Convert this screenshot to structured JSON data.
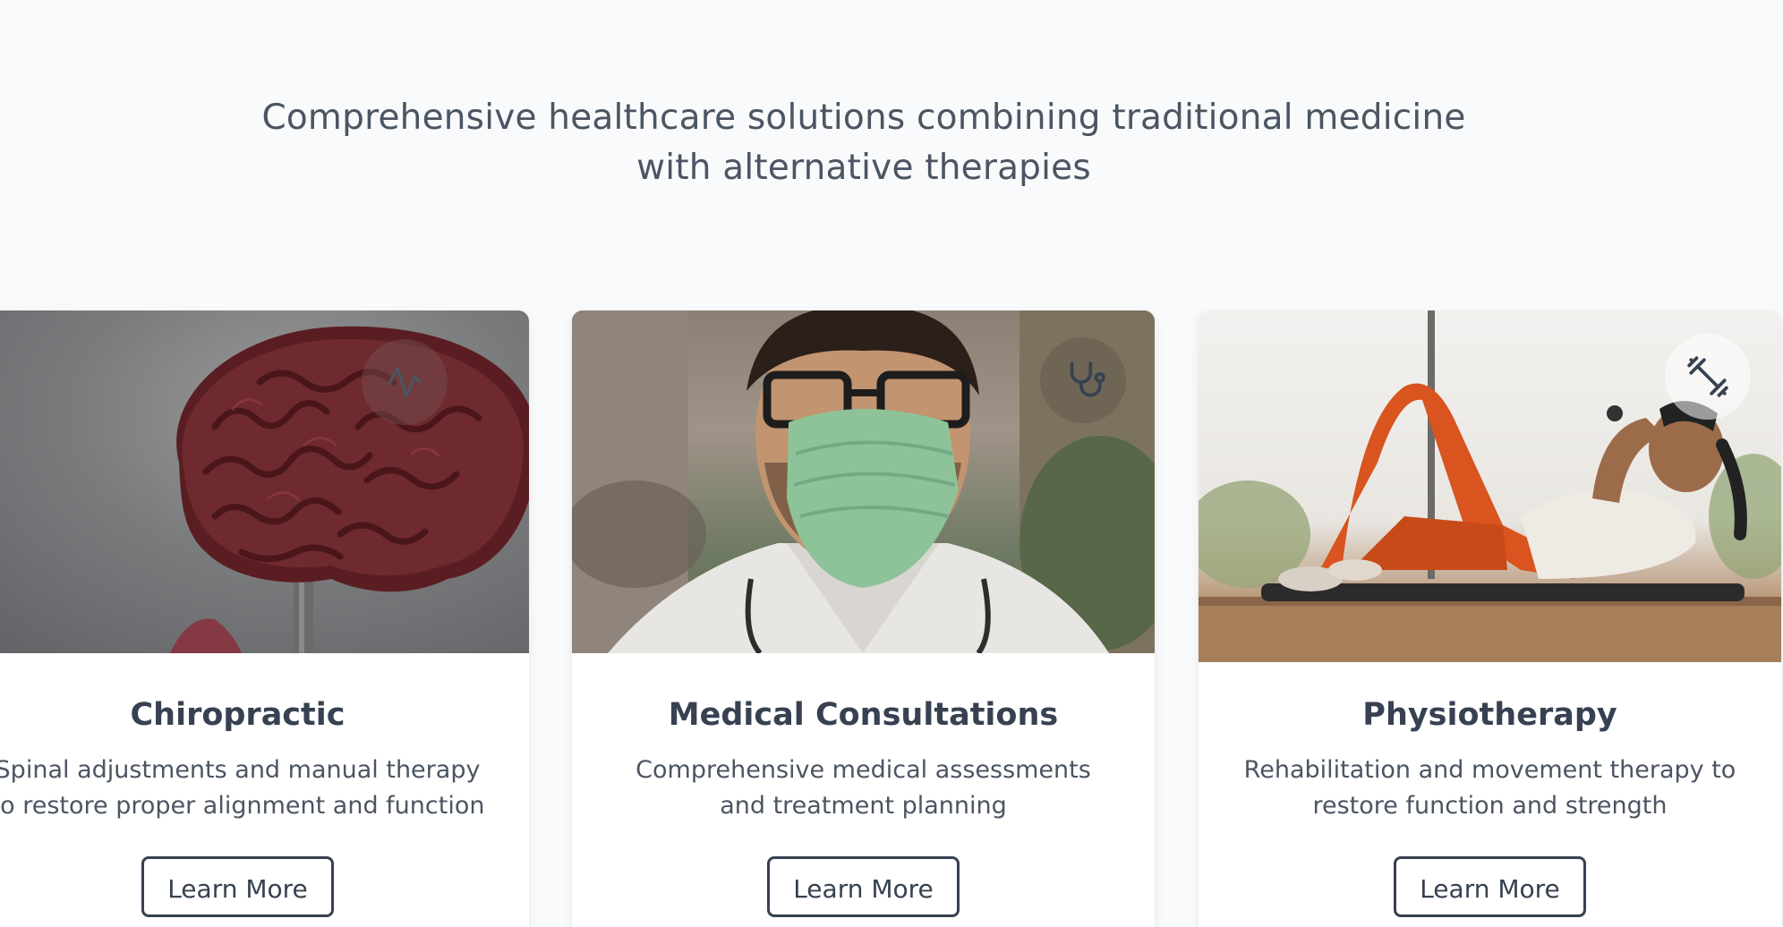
{
  "section": {
    "subtitle": "Comprehensive healthcare solutions combining traditional medicine with alternative therapies"
  },
  "services": [
    {
      "title": "Chiropractic",
      "description": "Spinal adjustments and manual therapy to restore proper alignment and function",
      "button_label": "Learn More",
      "icon": "activity-icon",
      "image": "anatomical brain model"
    },
    {
      "title": "Medical Consultations",
      "description": "Comprehensive medical assessments and treatment planning",
      "button_label": "Learn More",
      "icon": "stethoscope-icon",
      "image": "doctor wearing surgical mask"
    },
    {
      "title": "Physiotherapy",
      "description": "Rehabilitation and movement therapy to restore function and strength",
      "button_label": "Learn More",
      "icon": "dumbbell-icon",
      "image": "woman exercising on mat"
    }
  ],
  "colors": {
    "page_background": "#f9fafb",
    "text_heading": "#374151",
    "text_body": "#4b5563",
    "card_background": "#ffffff"
  }
}
